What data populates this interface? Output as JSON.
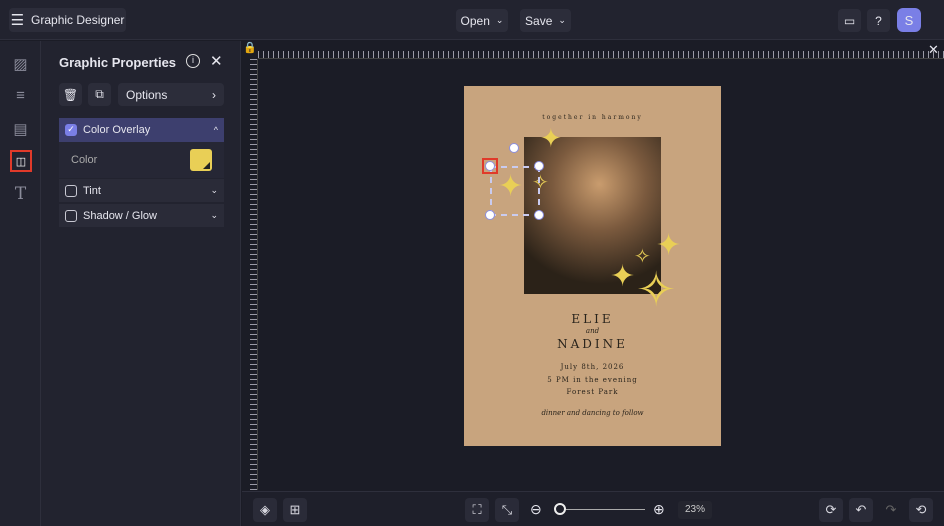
{
  "app": {
    "title": "Graphic Designer",
    "open_label": "Open",
    "save_label": "Save",
    "avatar": "S"
  },
  "panel": {
    "title": "Graphic Properties",
    "options_label": "Options",
    "sections": [
      {
        "label": "Color Overlay",
        "checked": true,
        "expanded": true
      },
      {
        "label": "Tint",
        "checked": false
      },
      {
        "label": "Shadow / Glow",
        "checked": false
      }
    ],
    "color_label": "Color",
    "overlay_color": "#e9cf56"
  },
  "card": {
    "tagline": "together in harmony",
    "name1": "ELIE",
    "and": "and",
    "name2": "NADINE",
    "date": "July 8th, 2026",
    "time": "5 PM in the evening",
    "place": "Forest Park",
    "footer": "dinner and dancing to follow"
  },
  "zoom": {
    "value": "23%",
    "slider_fraction": 0.0
  },
  "colors": {
    "accent": "#7a7fe6",
    "highlight": "#e03a2a",
    "bg": "#1b1c26"
  }
}
